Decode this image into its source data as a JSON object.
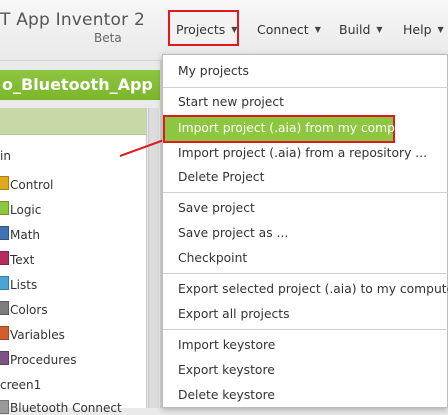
{
  "app": {
    "title": "T App Inventor 2",
    "subtitle": "Beta"
  },
  "nav": {
    "projects": "Projects",
    "connect": "Connect",
    "build": "Build",
    "help": "Help"
  },
  "project_name": "o_Bluetooth_App",
  "blocks_tree": {
    "builtin_label": "in",
    "items": [
      {
        "label": "Control",
        "color": "#e1a81e"
      },
      {
        "label": "Logic",
        "color": "#8dc63f"
      },
      {
        "label": "Math",
        "color": "#3f71b5"
      },
      {
        "label": "Text",
        "color": "#b32d5e"
      },
      {
        "label": "Lists",
        "color": "#49a6d4"
      },
      {
        "label": "Colors",
        "color": "#7d7d7d"
      },
      {
        "label": "Variables",
        "color": "#d05f2d"
      },
      {
        "label": "Procedures",
        "color": "#7c5385"
      }
    ],
    "screen_label": "creen1",
    "component_label": "Bluetooth Connect"
  },
  "menu": {
    "my_projects": "My projects",
    "start_new": "Start new project",
    "import_computer": "Import project (.aia) from my computer ...",
    "import_repo": "Import project (.aia) from a repository ...",
    "delete_project": "Delete Project",
    "save_project": "Save project",
    "save_as": "Save project as ...",
    "checkpoint": "Checkpoint",
    "export_selected": "Export selected project (.aia) to my computer",
    "export_all": "Export all projects",
    "import_keystore": "Import keystore",
    "export_keystore": "Export keystore",
    "delete_keystore": "Delete keystore"
  },
  "colors": {
    "accent_green": "#8dc63f",
    "highlight_red": "#e1191e"
  }
}
